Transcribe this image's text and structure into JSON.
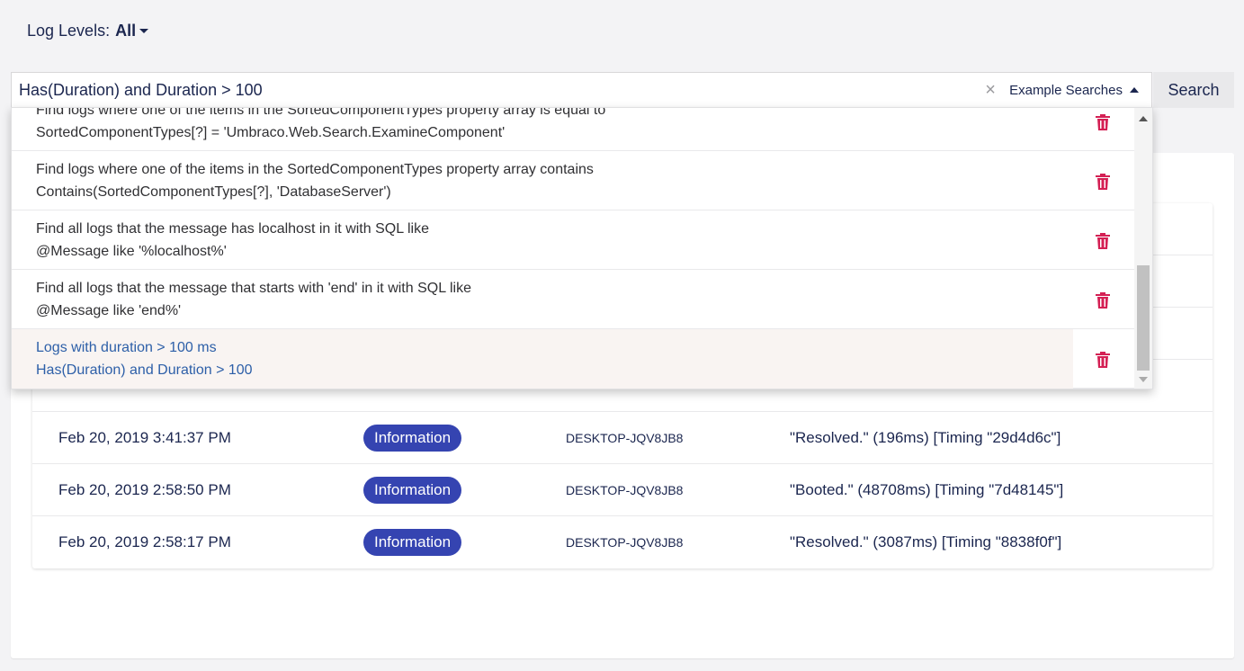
{
  "log_levels": {
    "label": "Log Levels:",
    "value": "All"
  },
  "search": {
    "value": "Has(Duration) and Duration > 100",
    "clear_icon": "×",
    "example_label": "Example Searches",
    "button_label": "Search"
  },
  "examples": [
    {
      "title": "Find logs where one of the items in the SortedComponentTypes property array is equal to",
      "query": "SortedComponentTypes[?] = 'Umbraco.Web.Search.ExamineComponent'"
    },
    {
      "title": "Find logs where one of the items in the SortedComponentTypes property array contains",
      "query": "Contains(SortedComponentTypes[?], 'DatabaseServer')"
    },
    {
      "title": "Find all logs that the message has localhost in it with SQL like",
      "query": "@Message like '%localhost%'"
    },
    {
      "title": "Find all logs that the message that starts with 'end' in it with SQL like",
      "query": "@Message like 'end%'"
    },
    {
      "title": "Logs with duration > 100 ms",
      "query": "Has(Duration) and Duration > 100"
    }
  ],
  "logs": [
    {
      "date": "Feb 20, 2019 3:41:37 PM",
      "level": "Information",
      "machine": "DESKTOP-JQV8JB8",
      "message": "\"Resolved.\" (196ms) [Timing \"29d4d6c\"]"
    },
    {
      "date": "Feb 20, 2019 2:58:50 PM",
      "level": "Information",
      "machine": "DESKTOP-JQV8JB8",
      "message": "\"Booted.\" (48708ms) [Timing \"7d48145\"]"
    },
    {
      "date": "Feb 20, 2019 2:58:17 PM",
      "level": "Information",
      "machine": "DESKTOP-JQV8JB8",
      "message": "\"Resolved.\" (3087ms) [Timing \"8838f0f\"]"
    }
  ],
  "colors": {
    "badge": "#3544b1",
    "trash": "#d42054",
    "highlight": "#f9f4f2",
    "active_text": "#2d5fa8"
  },
  "icons": {
    "trash": "trash-icon",
    "clear": "close-icon",
    "caret_down": "chevron-down-icon",
    "caret_up": "chevron-up-icon"
  }
}
